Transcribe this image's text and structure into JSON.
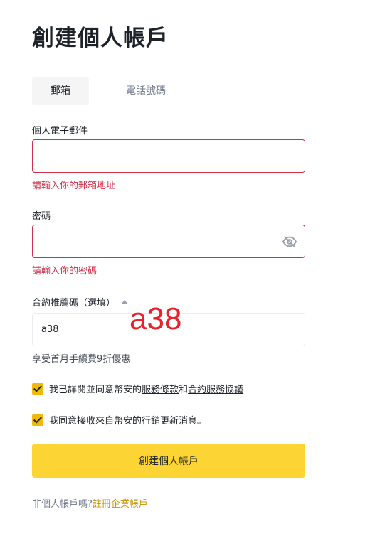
{
  "title": "創建個人帳戶",
  "tabs": [
    {
      "label": "郵箱",
      "active": true
    },
    {
      "label": "電話號碼",
      "active": false
    }
  ],
  "email": {
    "label": "個人電子郵件",
    "value": "",
    "error": "請輸入你的郵箱地址"
  },
  "password": {
    "label": "密碼",
    "value": "",
    "error": "請輸入你的密碼",
    "toggle_icon": "eye-off-icon"
  },
  "referral": {
    "label": "合約推薦碼（選填）",
    "value": "a38",
    "hint": "享受首月手續費9折優惠",
    "annotation": "a38"
  },
  "agreements": [
    {
      "checked": true,
      "prefix": "我已詳閱並同意幣安的",
      "link1": "服務條款",
      "mid": "和",
      "link2": "合約服務協議"
    },
    {
      "checked": true,
      "text": "我同意接收來自幣安的行銷更新消息。"
    }
  ],
  "submit_label": "創建個人帳戶",
  "footer": {
    "prefix": "非個人帳戶嗎?",
    "link": "註冊企業帳戶"
  },
  "colors": {
    "accent": "#fcd535",
    "checkbox": "#f0b90b",
    "error": "#cf304a",
    "link_gold": "#c99400",
    "annotation": "#e8222b"
  }
}
